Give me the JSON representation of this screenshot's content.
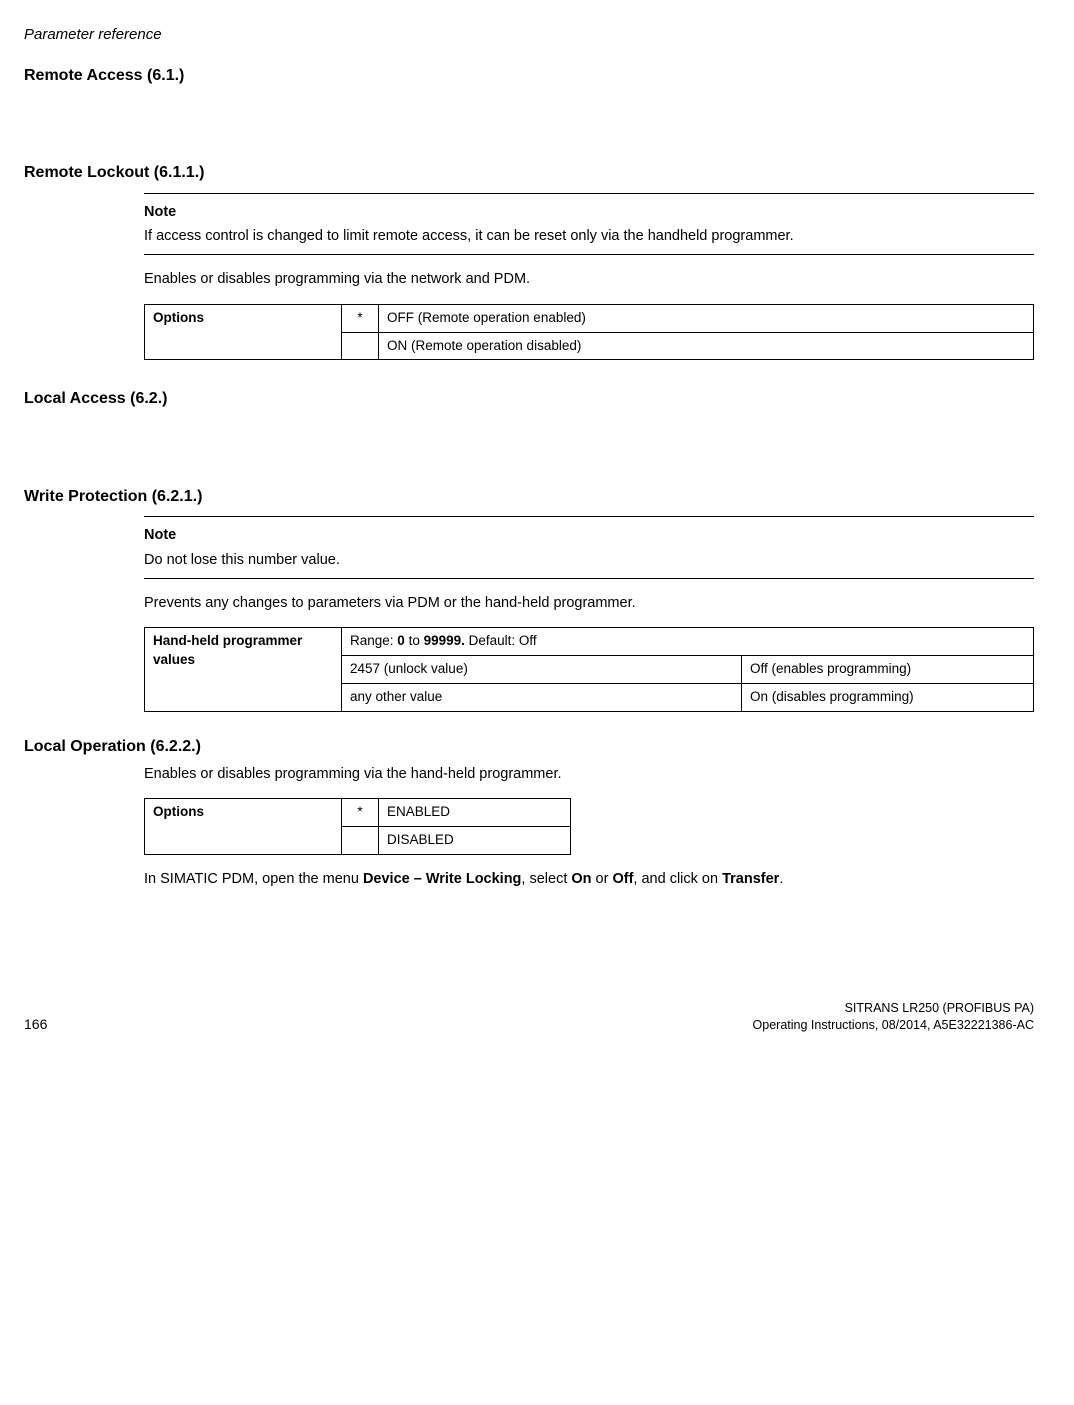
{
  "header": {
    "title": "Parameter reference"
  },
  "sections": {
    "remoteAccess": {
      "title": "Remote Access (6.1.)"
    },
    "remoteLockout": {
      "title": "Remote Lockout (6.1.1.)",
      "noteLabel": "Note",
      "noteText": "If access control is changed to limit remote access, it can be reset only via the handheld programmer.",
      "desc": "Enables or disables programming via the network and PDM.",
      "table": {
        "label": "Options",
        "rows": [
          {
            "star": "*",
            "text": "OFF (Remote operation enabled)"
          },
          {
            "star": "",
            "text": "ON (Remote operation disabled)"
          }
        ]
      }
    },
    "localAccess": {
      "title": "Local Access (6.2.)"
    },
    "writeProtection": {
      "title": "Write Protection (6.2.1.)",
      "noteLabel": "Note",
      "noteText": "Do not lose this number value.",
      "desc": "Prevents any changes to parameters via PDM or the hand-held programmer.",
      "table": {
        "label": "Hand-held programmer values",
        "rangePrefix": "Range: ",
        "rangeBold1": "0",
        "rangeMid": " to ",
        "rangeBold2": "99999.",
        "rangeSuffix": " Default: Off",
        "rows": [
          {
            "left": "2457 (unlock value)",
            "right": "Off (enables programming)"
          },
          {
            "left": "any other value",
            "right": "On (disables programming)"
          }
        ]
      }
    },
    "localOperation": {
      "title": "Local Operation (6.2.2.)",
      "desc": "Enables or disables programming via the hand-held programmer.",
      "table": {
        "label": "Options",
        "rows": [
          {
            "star": "*",
            "text": "ENABLED"
          },
          {
            "star": "",
            "text": "DISABLED"
          }
        ]
      },
      "tail1": "In SIMATIC PDM, open the menu ",
      "tailBold1": "Device – Write Locking",
      "tail2": ", select ",
      "tailBold2": "On",
      "tail3": " or ",
      "tailBold3": "Off",
      "tail4": ", and click on ",
      "tailBold4": "Transfer",
      "tail5": "."
    }
  },
  "footer": {
    "pageNumber": "166",
    "productLine": "SITRANS LR250 (PROFIBUS PA)",
    "docLine": "Operating Instructions, 08/2014, A5E32221386-AC"
  }
}
